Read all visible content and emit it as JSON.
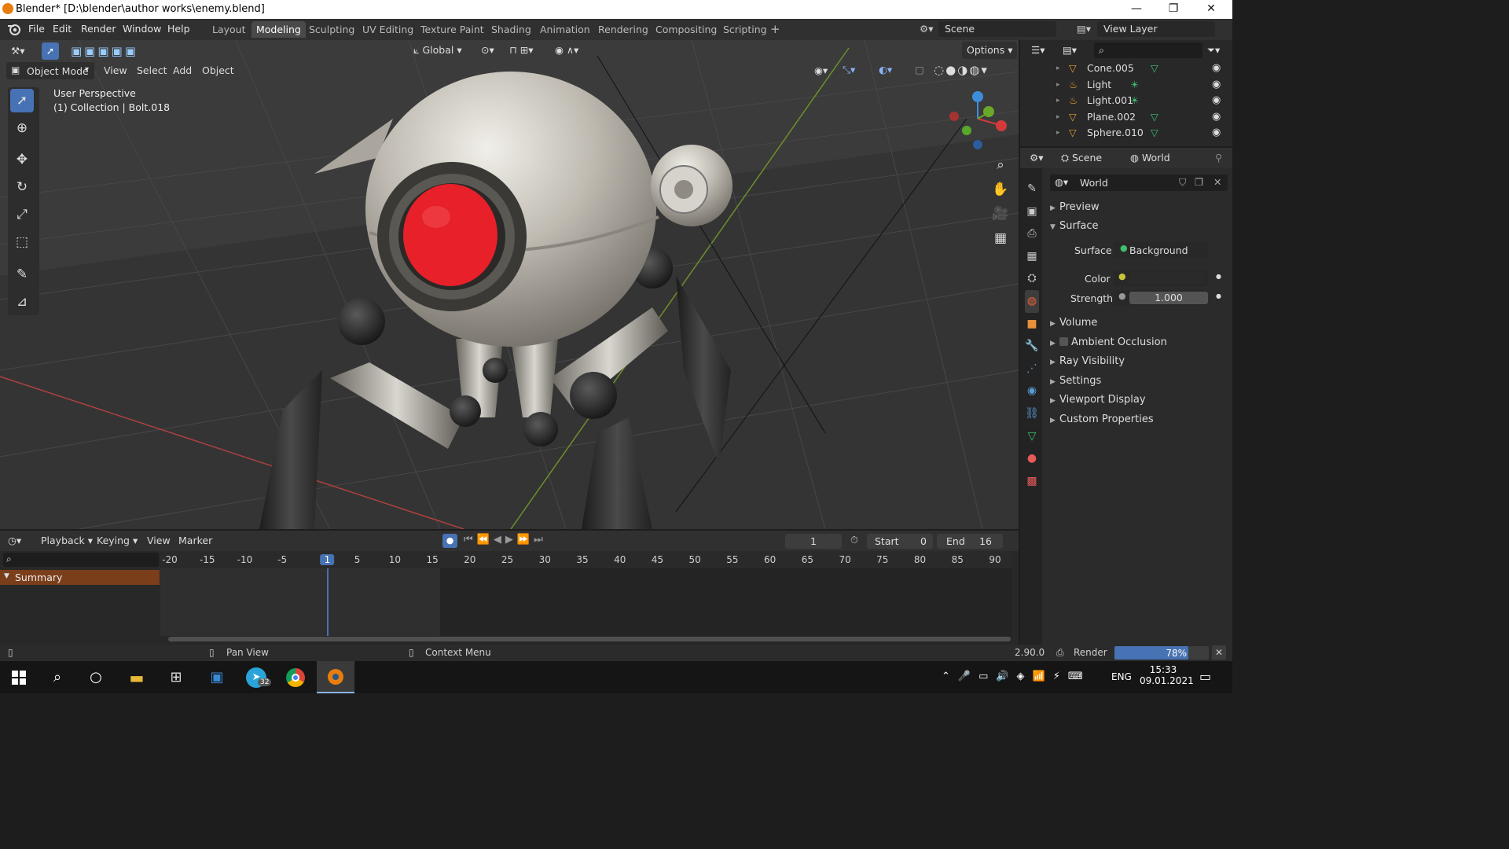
{
  "window": {
    "title": "Blender* [D:\\blender\\author works\\enemy.blend]",
    "minimize": "—",
    "maximize": "❐",
    "close": "✕"
  },
  "menu": [
    "File",
    "Edit",
    "Render",
    "Window",
    "Help"
  ],
  "workspaces": [
    "Layout",
    "Modeling",
    "Sculpting",
    "UV Editing",
    "Texture Paint",
    "Shading",
    "Animation",
    "Rendering",
    "Compositing",
    "Scripting"
  ],
  "active_workspace": "Modeling",
  "add_workspace": "+",
  "scene_field": "Scene",
  "view_layer_field": "View Layer",
  "viewport": {
    "transform_orientation": "Global",
    "options": "Options",
    "mode": "Object Mode",
    "menus": [
      "View",
      "Select",
      "Add",
      "Object"
    ],
    "info_line1": "User Perspective",
    "info_line2": "(1) Collection | Bolt.018"
  },
  "outliner": {
    "items": [
      {
        "name": "Cone.005",
        "icon": "mesh-icon"
      },
      {
        "name": "Light",
        "icon": "light-icon"
      },
      {
        "name": "Light.001",
        "icon": "light-icon"
      },
      {
        "name": "Plane.002",
        "icon": "mesh-icon"
      },
      {
        "name": "Sphere.010",
        "icon": "mesh-icon"
      }
    ]
  },
  "properties": {
    "tabs": [
      "Scene",
      "World"
    ],
    "world_name": "World",
    "sections": {
      "preview": "Preview",
      "surface": "Surface",
      "volume": "Volume",
      "ambient_occlusion": "Ambient Occlusion",
      "ray_visibility": "Ray Visibility",
      "settings": "Settings",
      "viewport_display": "Viewport Display",
      "custom_properties": "Custom Properties"
    },
    "surface_label": "Surface",
    "surface_value": "Background",
    "color_label": "Color",
    "strength_label": "Strength",
    "strength_value": "1.000"
  },
  "timeline": {
    "menus": [
      "Playback",
      "Keying",
      "View",
      "Marker"
    ],
    "current_frame": "1",
    "start_label": "Start",
    "start_value": "0",
    "end_label": "End",
    "end_value": "16",
    "ticks": [
      "-20",
      "-15",
      "-10",
      "-5",
      "1",
      "5",
      "10",
      "15",
      "20",
      "25",
      "30",
      "35",
      "40",
      "45",
      "50",
      "55",
      "60",
      "65",
      "70",
      "75",
      "80",
      "85",
      "90"
    ],
    "summary": "Summary"
  },
  "status": {
    "pan_view": "Pan View",
    "context_menu": "Context Menu",
    "version": "2.90.0",
    "render_label": "Render",
    "render_progress": "78%",
    "render_fraction": 0.78
  },
  "taskbar": {
    "lang": "ENG",
    "time": "15:33",
    "date": "09.01.2021",
    "telegram_badge": "32"
  },
  "colors": {
    "accent": "#4772b3",
    "orange": "#e87d0d",
    "red_eye": "#e8202a"
  }
}
